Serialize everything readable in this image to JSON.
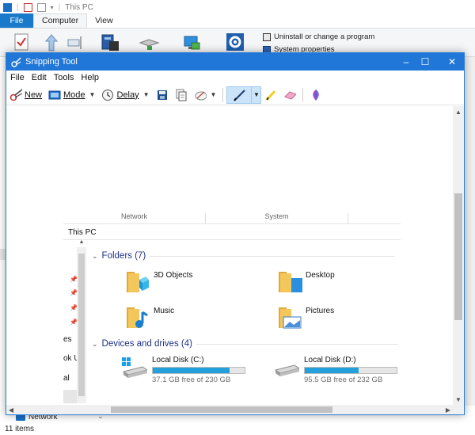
{
  "background": {
    "title": "This PC",
    "tabs": [
      "File",
      "Computer",
      "View"
    ],
    "ribbon_commands": [
      "Uninstall or change a program",
      "System properties"
    ],
    "nav_item": "Network",
    "status": "11 items"
  },
  "snip": {
    "title": "Snipping Tool",
    "menu": [
      "File",
      "Edit",
      "Tools",
      "Help"
    ],
    "toolbar": {
      "new_label": "New",
      "mode_label": "Mode",
      "delay_label": "Delay"
    },
    "window_controls": {
      "minimize": "–",
      "maximize": "☐",
      "close": "✕"
    }
  },
  "capture": {
    "ribbon_groups": [
      "Network",
      "System"
    ],
    "address": "This PC",
    "nav_fragments": [
      "es",
      "ok U",
      "al"
    ],
    "folders_header": "Folders (7)",
    "folders": [
      {
        "label": "3D Objects",
        "icon": "3d-objects-folder-icon"
      },
      {
        "label": "Desktop",
        "icon": "desktop-folder-icon"
      },
      {
        "label": "Music",
        "icon": "music-folder-icon"
      },
      {
        "label": "Pictures",
        "icon": "pictures-folder-icon"
      }
    ],
    "drives_header": "Devices and drives (4)",
    "drives": [
      {
        "name": "Local Disk (C:)",
        "free": "37.1 GB free of 230 GB",
        "used_fraction": 0.84
      },
      {
        "name": "Local Disk (D:)",
        "free": "95.5 GB free of 232 GB",
        "used_fraction": 0.59
      }
    ],
    "colors": {
      "accent": "#2077d7",
      "group_header": "#1e3287",
      "drive_bar": "#26a0da",
      "folder": "#f0c04a"
    }
  }
}
